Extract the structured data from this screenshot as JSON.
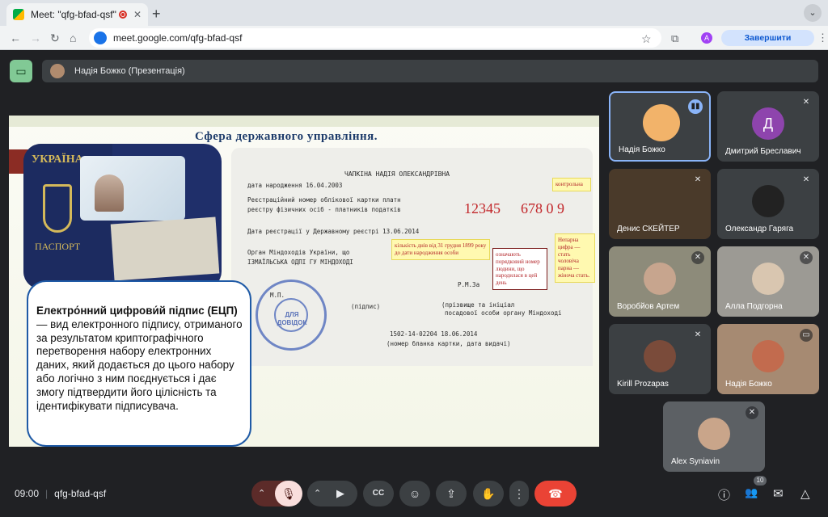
{
  "browser": {
    "tab_title": "Meet: \"qfg-bfad-qsf\"",
    "tab_close": "✕",
    "new_tab": "+",
    "tab_menu": "⌄",
    "url": "meet.google.com/qfg-bfad-qsf",
    "profile_initial": "A",
    "update_label": "Завершити оновлення",
    "back": "←",
    "forward": "→",
    "reload": "↻",
    "home": "⌂",
    "bookmark": "☆",
    "extensions": "⧉",
    "menu": "⋮"
  },
  "presentation_bar": {
    "label": "Надія Божко (Презентація)"
  },
  "slide": {
    "title": "Сфера державного управління.",
    "passport": {
      "country": "УКРАЇНА",
      "word": "ПАСПОРТ"
    },
    "document": {
      "name": "ЧАПКІНА НАДІЯ ОЛЕКСАНДРІВНА",
      "dob": "дата народження  16.04.2003",
      "reg1": "Реєстраційний номер облікової картки платн",
      "reg2": "реєстру фізичних осіб - платників податків",
      "reg_date": "Дата реєстрації у Державному реєстрі 13.06.2014",
      "org1": "Орган Міндоходів України, що",
      "org2": "ІЗМАЇЛЬСЬКА ОДПІ ГУ МІНДОХОДІ",
      "mp": "М.П.",
      "signature": "(підпис)",
      "officer": "Р.М.За",
      "officer_desc1": "(прізвище та ініціал",
      "officer_desc2": "посадової особи органу Міндоході",
      "card_no": "1502-14-02204    18.06.2014",
      "card_desc": "(номер бланка картки, дата видачі)",
      "digits1": "12345",
      "digits2": "678 0  9",
      "stamp_text": "ДЛЯ ДОВІДОК"
    },
    "notes": {
      "control": "контрольна",
      "days": "кількість днів від  31 грудня 1899 року до дати народження особи",
      "serial": "означають порядковий номер людини, що народилася в цей день",
      "gender": "Непарна цифра — стать чоловіча парна — жіноча стать."
    },
    "callout": {
      "term": "Електро́нний цифрови́й підпис (ЕЦП)",
      "text": " — вид електронного підпису, отриманого за результатом криптографічного перетворення набору електронних даних, який додається до цього набору або логічно з ним поєднується і дає змогу підтвердити його цілісність та ідентифікувати підписувача."
    }
  },
  "participants": [
    {
      "name": "Надія Божко",
      "state": "speaking",
      "avatar_color": "#f2b36a"
    },
    {
      "name": "Дмитрий Бреславич",
      "initial": "Д",
      "state": "muted",
      "avatar_color": "#8e44ad"
    },
    {
      "name": "Денис СКЕЙТЕР",
      "state": "muted"
    },
    {
      "name": "Олександр Гаряга",
      "state": "muted"
    },
    {
      "name": "Воробйов Артем",
      "state": "muted"
    },
    {
      "name": "Алла Подгорна",
      "state": "muted"
    },
    {
      "name": "Kirill Prozapas",
      "state": "muted"
    },
    {
      "name": "Надія Божко",
      "state": "presenting"
    },
    {
      "name": "Alex Syniavin",
      "state": "muted"
    }
  ],
  "controls": {
    "time": "09:00",
    "meeting_code": "qfg-bfad-qsf",
    "participant_count": "10",
    "icons": {
      "caret_up": "⌃",
      "mic_off": "🎙",
      "camera": "▶",
      "captions": "CC",
      "emoji": "☺",
      "present": "⇪",
      "hand": "✋",
      "more": "⋮",
      "end": "☎",
      "info": "ⓘ",
      "people": "👥",
      "chat": "✉",
      "activities": "△"
    }
  }
}
